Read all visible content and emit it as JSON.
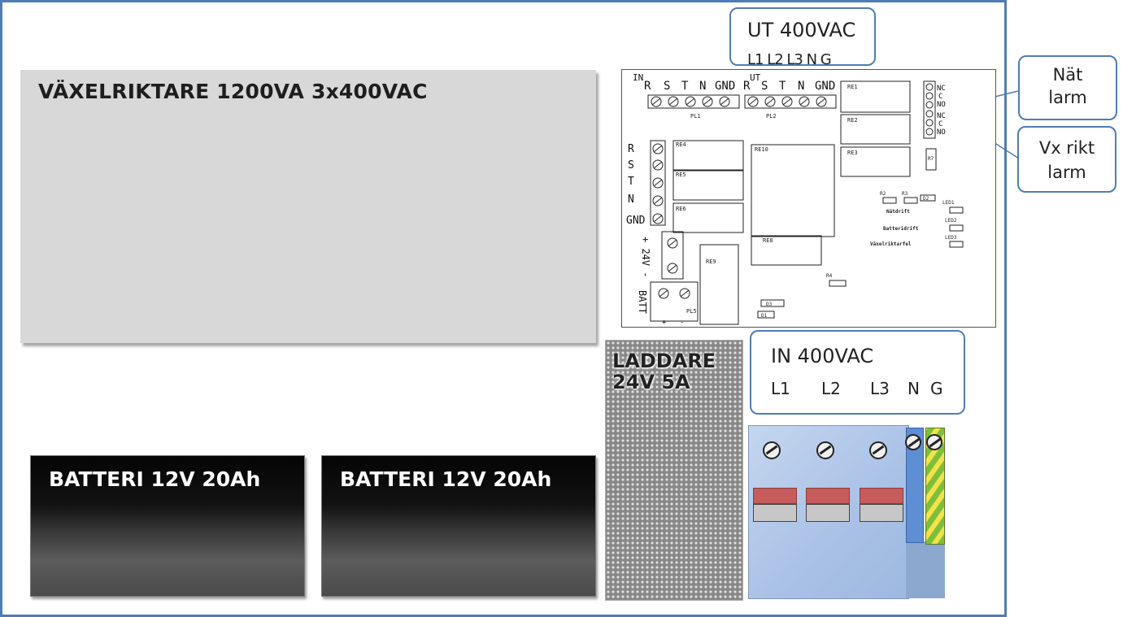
{
  "inverter": {
    "title": "VÄXELRIKTARE 1200VA 3x400VAC"
  },
  "batteries": [
    {
      "label": "BATTERI 12V 20Ah"
    },
    {
      "label": "BATTERI 12V 20Ah"
    }
  ],
  "charger": {
    "label": "LADDARE\n24V 5A"
  },
  "output_box": {
    "title": "UT 400VAC",
    "terminals": "L1 L2 L3 N G"
  },
  "input_box": {
    "title": "IN 400VAC",
    "terminals": [
      "L1",
      "L2",
      "L3",
      "N",
      "G"
    ]
  },
  "alarms": {
    "grid_alarm": "Nät\nlarm",
    "inverter_alarm": "Vx rikt\nlarm"
  },
  "pcb": {
    "in_label": "IN",
    "ut_label": "UT",
    "pl1_terminals": [
      "R",
      "S",
      "T",
      "N",
      "GND"
    ],
    "pl2_terminals": [
      "R",
      "S",
      "T",
      "N",
      "GND"
    ],
    "pl1": "PL1",
    "pl2": "PL2",
    "side_terminals": [
      "R",
      "S",
      "T",
      "N",
      "GND"
    ],
    "relays": [
      "RE1",
      "RE2",
      "RE3",
      "RE4",
      "RE5",
      "RE6",
      "RE8",
      "RE9",
      "RE10"
    ],
    "alarm_pins_top": [
      "NC",
      "C",
      "NO"
    ],
    "alarm_pins_bottom": [
      "NC",
      "C",
      "NO"
    ],
    "power_label": "+ 24V -",
    "batt_label": "BATT",
    "pl5": "PL5",
    "resistors": [
      "R2",
      "R3",
      "R4",
      "R7"
    ],
    "diodes": [
      "D1",
      "D2",
      "D3"
    ],
    "leds": [
      "LED1",
      "LED2",
      "LED3"
    ],
    "status_labels": [
      "Nätdrift",
      "Batteridrift",
      "Växelriktarfel"
    ],
    "batt_polarity": [
      "+",
      "-"
    ]
  },
  "colors": {
    "frame": "#4f7db5",
    "inverter_bg": "#d8d8d8",
    "breaker_red": "#c65c5c",
    "terminal_blue": "#a9c1e6",
    "neutral_rail": "#5e8fd4"
  }
}
